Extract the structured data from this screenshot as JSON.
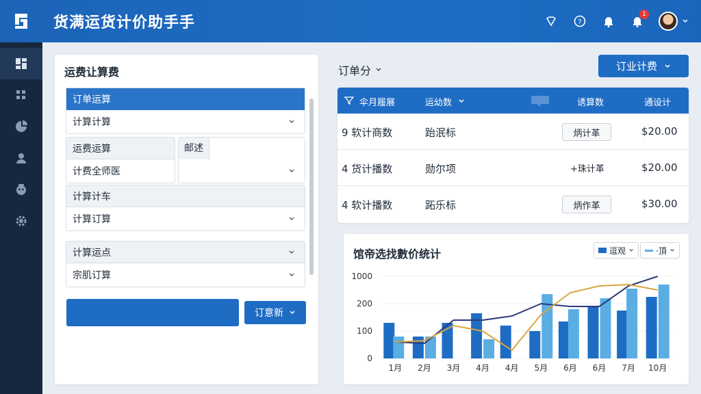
{
  "app": {
    "title": "货满运货计价助手手"
  },
  "header": {
    "notification_count": "1"
  },
  "sidebar": {
    "items": [
      {
        "icon": "dashboard-icon"
      },
      {
        "icon": "grid-icon"
      },
      {
        "icon": "pie-chart-icon"
      },
      {
        "icon": "user-icon"
      },
      {
        "icon": "robot-icon"
      },
      {
        "icon": "gear-icon"
      }
    ]
  },
  "left_panel": {
    "title": "运费让算费",
    "group1": {
      "header": "订单运算",
      "value": "计算计算"
    },
    "group2": {
      "header": "运费运算",
      "value": "计费全师医"
    },
    "group2b": {
      "header": "邮述"
    },
    "group3": {
      "header": "计算计车",
      "value": "计算订算"
    },
    "group4": {
      "header": "计算运点",
      "value": "宗肌订算"
    },
    "split_button": "订意新"
  },
  "orders": {
    "title": "订单分",
    "top_button": "订业计费",
    "columns": [
      "伞月履展",
      "运幼数",
      "诱算数",
      "通设计"
    ],
    "rows": [
      {
        "item": "9 软计商数",
        "desc": "跆泯标",
        "action": "炳计革",
        "action_style": "button",
        "price": "$20.00"
      },
      {
        "item": "4 货计播数",
        "desc": "勋尔项",
        "action": "+珠计革",
        "action_style": "plain",
        "price": "$20.00"
      },
      {
        "item": "4 软计播数",
        "desc": "跖乐标",
        "action": "炳作革",
        "action_style": "button",
        "price": "$30.00"
      }
    ]
  },
  "chart_data": {
    "type": "bar",
    "title": "馆帝选找數价统计",
    "legend_selects": [
      "逗观",
      "·頂"
    ],
    "categories": [
      "1月",
      "2月",
      "3月",
      "4月",
      "4月",
      "5月",
      "6月",
      "6月",
      "7月",
      "10月"
    ],
    "y_ticks": [
      "0",
      "100",
      "200",
      "1000"
    ],
    "series": [
      {
        "values": [
          130,
          80,
          130,
          165,
          120,
          100,
          135,
          190,
          175,
          225
        ]
      },
      {
        "values": [
          80,
          80,
          0,
          70,
          0,
          235,
          180,
          220,
          255,
          270
        ]
      }
    ],
    "lines": [
      {
        "values": [
          60,
          55,
          140,
          140,
          155,
          200,
          190,
          190,
          265,
          300
        ]
      },
      {
        "values": [
          60,
          65,
          120,
          100,
          30,
          160,
          240,
          265,
          270,
          250
        ]
      }
    ],
    "colors": {
      "bar_dark": "#1f6cc4",
      "bar_light": "#5aaee3",
      "line_dark": "#2c3a7a",
      "line_gold": "#d9a640",
      "line_red": "#9b2a3a"
    }
  }
}
